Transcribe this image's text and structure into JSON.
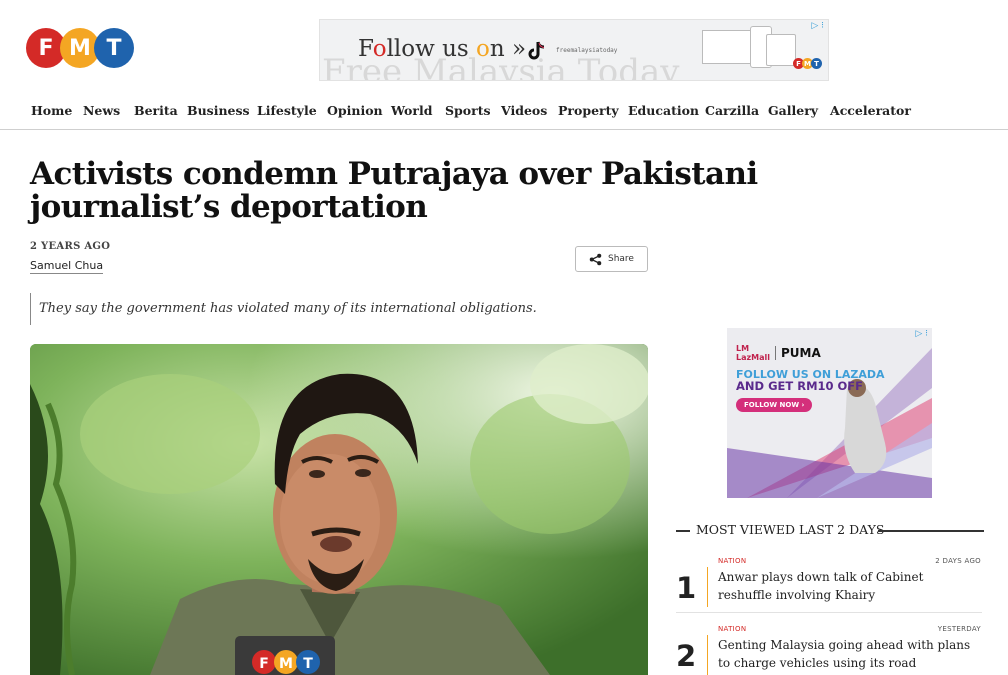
{
  "site": {
    "logo_letters": [
      "F",
      "M",
      "T"
    ],
    "brand_colors": {
      "red": "#d42a27",
      "orange": "#f4a623",
      "blue": "#1f63ad"
    }
  },
  "top_ad": {
    "follow_text_parts": [
      "F",
      "o",
      "llow us ",
      "o",
      "n »"
    ],
    "handle": "freemalaysiatoday",
    "background_text": "Free Malaysia Today",
    "icons": [
      "tiktok-icon",
      "ad-choices-icon"
    ]
  },
  "nav": {
    "items": [
      "Home",
      "News",
      "Berita",
      "Business",
      "Lifestyle",
      "Opinion",
      "World",
      "Sports",
      "Videos",
      "Property",
      "Education",
      "Carzilla",
      "Gallery",
      "Accelerator"
    ]
  },
  "article": {
    "title": "Activists condemn Putrajaya over Pakistani journalist’s deportation",
    "time_ago": "2 YEARS AGO",
    "author": "Samuel Chua",
    "share_label": "Share",
    "standfirst": "They say the government has violated many of its international obligations.",
    "photo_watermark": [
      "F",
      "M",
      "T"
    ]
  },
  "side_ad": {
    "brand1_line1": "LM",
    "brand1_line2": "LazMall",
    "brand2": "PUMA",
    "line1": "FOLLOW US ON LAZADA",
    "line2": "AND GET RM10 OFF",
    "cta": "FOLLOW NOW  ›"
  },
  "most_viewed": {
    "title": "MOST VIEWED LAST 2 DAYS",
    "items": [
      {
        "rank": "1",
        "category": "NATION",
        "time": "2 DAYS AGO",
        "headline": "Anwar plays down talk of Cabinet reshuffle involving Khairy"
      },
      {
        "rank": "2",
        "category": "NATION",
        "time": "YESTERDAY",
        "headline": "Genting Malaysia going ahead with plans to charge vehicles using its road"
      }
    ]
  }
}
